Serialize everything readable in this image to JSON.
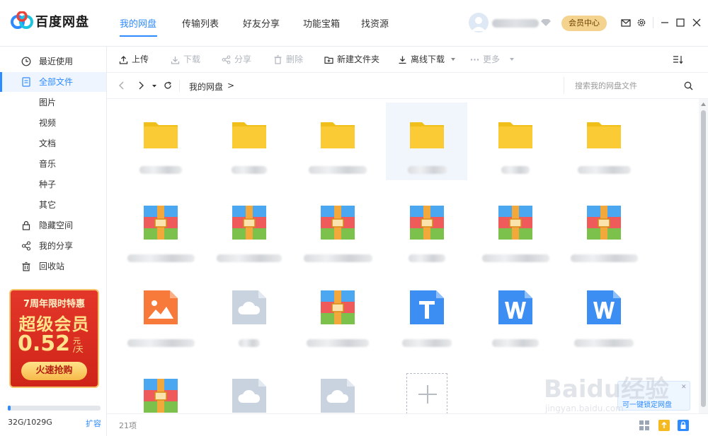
{
  "app": {
    "title": "百度网盘",
    "brand_color": "#2e8bff"
  },
  "nav": {
    "tabs": [
      {
        "label": "我的网盘",
        "active": true
      },
      {
        "label": "传输列表",
        "active": false
      },
      {
        "label": "好友分享",
        "active": false
      },
      {
        "label": "功能宝箱",
        "active": false
      },
      {
        "label": "找资源",
        "active": false
      }
    ],
    "vip_center_label": "会员中心"
  },
  "sidebar": {
    "items": [
      {
        "label": "最近使用",
        "icon": "clock-icon"
      },
      {
        "label": "全部文件",
        "icon": "document-icon",
        "active": true
      },
      {
        "label": "图片"
      },
      {
        "label": "视频"
      },
      {
        "label": "文档"
      },
      {
        "label": "音乐"
      },
      {
        "label": "种子"
      },
      {
        "label": "其它"
      },
      {
        "label": "隐藏空间",
        "icon": "lock-icon"
      },
      {
        "label": "我的分享",
        "icon": "share-icon"
      },
      {
        "label": "回收站",
        "icon": "trash-icon"
      }
    ],
    "promo": {
      "subtitle": "7周年限时特惠",
      "title": "超级会员",
      "price": "0.52",
      "unit_top": "元",
      "unit_bottom": "/天",
      "button": "火速抢购"
    },
    "storage": {
      "used_text": "32G/1029G",
      "used_fraction": 0.031,
      "expand_label": "扩容"
    }
  },
  "toolbar": {
    "upload": "上传",
    "download": "下载",
    "share": "分享",
    "delete": "删除",
    "new_folder": "新建文件夹",
    "offline_download": "离线下载",
    "more": "更多"
  },
  "pathbar": {
    "crumb": "我的网盘",
    "separator": ">",
    "search_placeholder": "搜索我的网盘文件"
  },
  "files": [
    {
      "type": "folder",
      "selected": false
    },
    {
      "type": "folder",
      "selected": false
    },
    {
      "type": "folder",
      "selected": false
    },
    {
      "type": "folder",
      "selected": true
    },
    {
      "type": "folder",
      "selected": false
    },
    {
      "type": "folder",
      "selected": false
    },
    {
      "type": "archive"
    },
    {
      "type": "archive"
    },
    {
      "type": "archive"
    },
    {
      "type": "archive"
    },
    {
      "type": "archive"
    },
    {
      "type": "archive"
    },
    {
      "type": "image"
    },
    {
      "type": "cloud"
    },
    {
      "type": "archive"
    },
    {
      "type": "text"
    },
    {
      "type": "word"
    },
    {
      "type": "word"
    },
    {
      "type": "archive"
    },
    {
      "type": "cloud"
    },
    {
      "type": "cloud"
    }
  ],
  "status": {
    "count": "21项"
  },
  "lock_popup": {
    "text": "可一键锁定网盘"
  },
  "watermark": {
    "main": "Baidu经验",
    "sub": "jingyan.baidu.com"
  }
}
